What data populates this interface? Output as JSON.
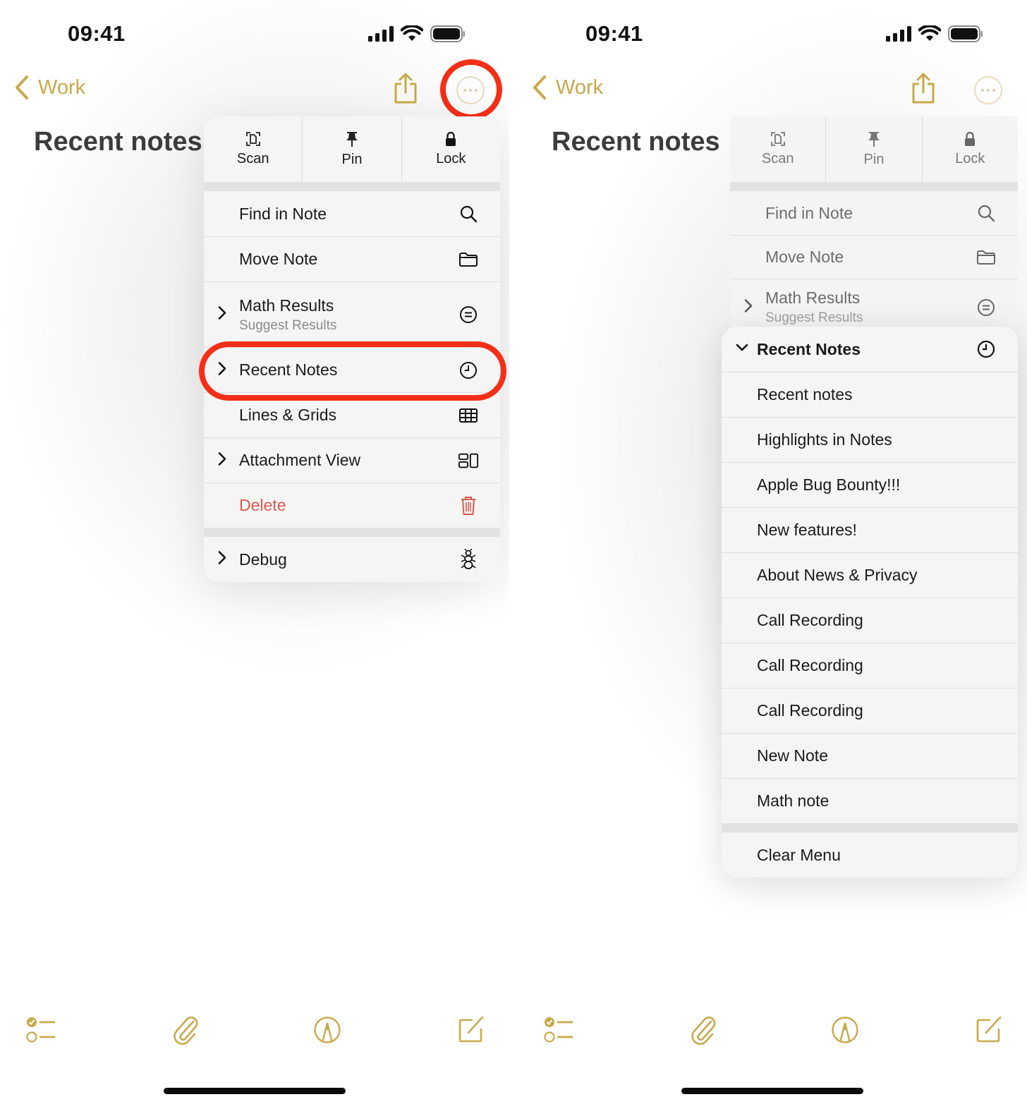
{
  "colors": {
    "accent": "#c8a94a",
    "highlight_ring": "#f42f17",
    "danger": "#d95a4f"
  },
  "screens": [
    {
      "status": {
        "time": "09:41",
        "icons": [
          "cellular-signal-icon",
          "wifi-icon",
          "battery-icon"
        ]
      },
      "nav": {
        "back_label": "Work",
        "back_icon": "chevron-left-icon",
        "share_icon": "share-icon",
        "more_icon": "ellipsis-circle-icon"
      },
      "title": "Recent notes",
      "menu": {
        "quick_actions": [
          {
            "label": "Scan",
            "icon": "scan-document-icon"
          },
          {
            "label": "Pin",
            "icon": "pin-icon"
          },
          {
            "label": "Lock",
            "icon": "lock-icon"
          }
        ],
        "items": [
          {
            "label": "Find in Note",
            "icon": "magnifying-glass-icon",
            "submenu": false
          },
          {
            "label": "Move Note",
            "icon": "folder-icon",
            "submenu": false
          },
          {
            "label": "Math Results",
            "sublabel": "Suggest Results",
            "icon": "equal-circle-icon",
            "submenu": true
          },
          {
            "label": "Recent Notes",
            "icon": "clock-icon",
            "submenu": true,
            "highlighted": true
          },
          {
            "label": "Lines & Grids",
            "icon": "grid-icon",
            "submenu": false
          },
          {
            "label": "Attachment View",
            "icon": "attachment-view-icon",
            "submenu": true
          },
          {
            "label": "Delete",
            "icon": "trash-icon",
            "submenu": false,
            "destructive": true
          }
        ],
        "footer_items": [
          {
            "label": "Debug",
            "icon": "ant-icon",
            "submenu": true
          }
        ]
      },
      "toolbar": [
        "checklist-icon",
        "paperclip-icon",
        "markup-pen-icon",
        "compose-icon"
      ]
    },
    {
      "status": {
        "time": "09:41"
      },
      "nav": {
        "back_label": "Work"
      },
      "title": "Recent notes",
      "menu_dimmed": {
        "quick_actions": [
          {
            "label": "Scan"
          },
          {
            "label": "Pin"
          },
          {
            "label": "Lock"
          }
        ],
        "items": [
          {
            "label": "Find in Note"
          },
          {
            "label": "Move Note"
          },
          {
            "label": "Math Results",
            "sublabel": "Suggest Results"
          }
        ]
      },
      "submenu": {
        "header": "Recent Notes",
        "header_icon": "clock-icon",
        "notes": [
          "Recent notes",
          "Highlights in Notes",
          "Apple Bug Bounty!!!",
          "New features!",
          "About News & Privacy",
          "Call Recording",
          "Call Recording",
          "Call Recording",
          "New Note",
          "Math note"
        ],
        "clear_label": "Clear Menu"
      }
    }
  ]
}
